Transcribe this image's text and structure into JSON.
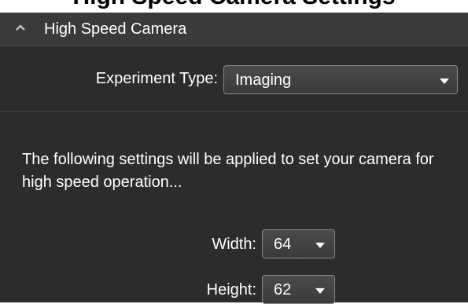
{
  "page": {
    "cut_heading": "High Speed Camera Settings"
  },
  "section": {
    "title": "High Speed Camera",
    "collapse_icon": "chevron-up-icon",
    "experiment_type_label": "Experiment Type:",
    "experiment_type_value": "Imaging",
    "description": "The following settings will be applied to set your camera for high speed operation...",
    "width_label": "Width:",
    "width_value": "64",
    "height_label": "Height:",
    "height_value": "62"
  },
  "colors": {
    "panel_bg": "#2c2c2c",
    "header_bg": "#3a3a3a",
    "text": "#ffffff",
    "dropdown_border": "#8a8a8a"
  }
}
